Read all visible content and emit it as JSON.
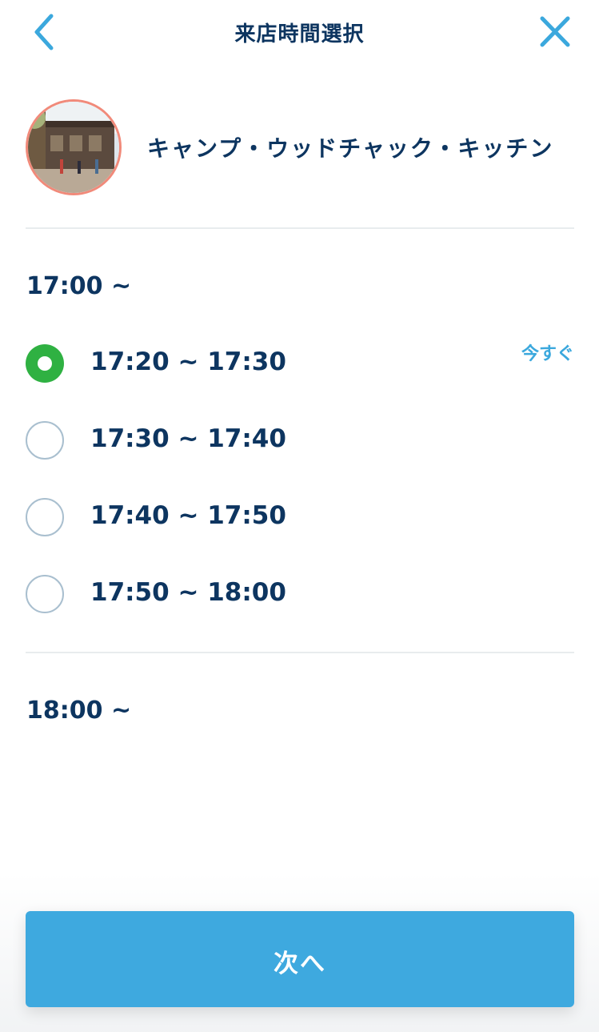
{
  "header": {
    "title": "来店時間選択",
    "back_icon": "chevron-left-icon",
    "close_icon": "close-icon",
    "accent_color": "#3ba8dd"
  },
  "restaurant": {
    "name": "キャンプ・ウッドチャック・キッチン",
    "photo_icon": "restaurant-photo"
  },
  "time_groups": [
    {
      "header": "17:00 ~",
      "slots": [
        {
          "label": "17:20 ~ 17:30",
          "selected": true,
          "badge": "今すぐ"
        },
        {
          "label": "17:30 ~ 17:40",
          "selected": false,
          "badge": ""
        },
        {
          "label": "17:40 ~ 17:50",
          "selected": false,
          "badge": ""
        },
        {
          "label": "17:50 ~ 18:00",
          "selected": false,
          "badge": ""
        }
      ]
    },
    {
      "header": "18:00 ~",
      "slots": []
    }
  ],
  "footer": {
    "next_label": "次へ",
    "button_color": "#3ea9df"
  },
  "colors": {
    "text_primary": "#0d3560",
    "selected_radio": "#2fb142",
    "avatar_ring": "#f18a7a"
  }
}
